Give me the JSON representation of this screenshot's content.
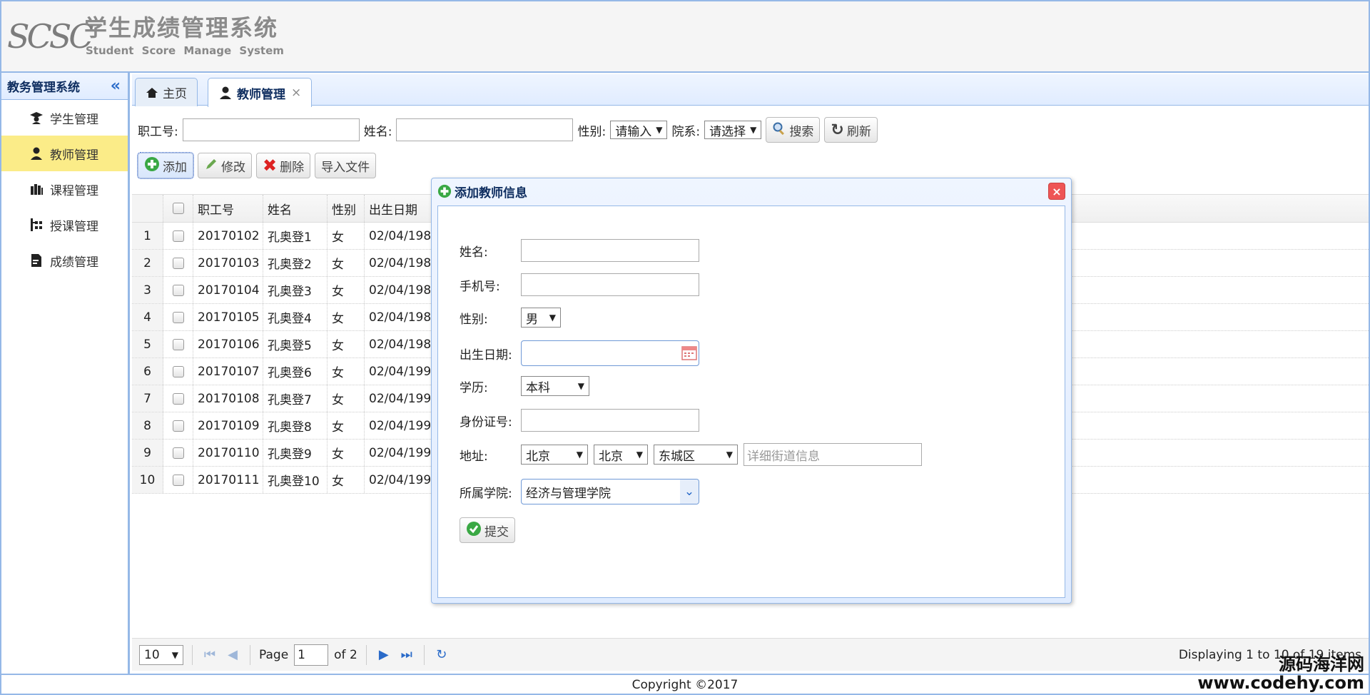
{
  "header": {
    "logo_mark": "SCSC",
    "title": "学生成绩管理系统",
    "subtitle": "Student Score Manage System"
  },
  "sidebar": {
    "title": "教务管理系统",
    "collapse_icon": "double-chevron-left-icon",
    "items": [
      {
        "label": "学生管理",
        "icon": "graduate-icon"
      },
      {
        "label": "教师管理",
        "icon": "teacher-icon",
        "active": true
      },
      {
        "label": "课程管理",
        "icon": "books-icon"
      },
      {
        "label": "授课管理",
        "icon": "hierarchy-icon"
      },
      {
        "label": "成绩管理",
        "icon": "document-icon"
      }
    ]
  },
  "tabs": [
    {
      "label": "主页",
      "icon": "home-icon"
    },
    {
      "label": "教师管理",
      "icon": "teacher-icon",
      "active": true,
      "close": "×"
    }
  ],
  "search": {
    "id_label": "职工号:",
    "name_label": "姓名:",
    "gender_label": "性别:",
    "gender_value": "请输入",
    "dept_label": "院系:",
    "dept_value": "请选择",
    "search_btn": "搜索",
    "refresh_btn": "刷新"
  },
  "actions": {
    "add": "添加",
    "edit": "修改",
    "delete": "删除",
    "import": "导入文件"
  },
  "table": {
    "columns": [
      "职工号",
      "姓名",
      "性别",
      "出生日期"
    ],
    "rows": [
      {
        "no": "1",
        "id": "20170102",
        "name": "孔奥登1",
        "gender": "女",
        "birth": "02/04/198"
      },
      {
        "no": "2",
        "id": "20170103",
        "name": "孔奥登2",
        "gender": "女",
        "birth": "02/04/198"
      },
      {
        "no": "3",
        "id": "20170104",
        "name": "孔奥登3",
        "gender": "女",
        "birth": "02/04/198"
      },
      {
        "no": "4",
        "id": "20170105",
        "name": "孔奥登4",
        "gender": "女",
        "birth": "02/04/198"
      },
      {
        "no": "5",
        "id": "20170106",
        "name": "孔奥登5",
        "gender": "女",
        "birth": "02/04/198"
      },
      {
        "no": "6",
        "id": "20170107",
        "name": "孔奥登6",
        "gender": "女",
        "birth": "02/04/199"
      },
      {
        "no": "7",
        "id": "20170108",
        "name": "孔奥登7",
        "gender": "女",
        "birth": "02/04/199"
      },
      {
        "no": "8",
        "id": "20170109",
        "name": "孔奥登8",
        "gender": "女",
        "birth": "02/04/199"
      },
      {
        "no": "9",
        "id": "20170110",
        "name": "孔奥登9",
        "gender": "女",
        "birth": "02/04/199"
      },
      {
        "no": "10",
        "id": "20170111",
        "name": "孔奥登10",
        "gender": "女",
        "birth": "02/04/199"
      }
    ]
  },
  "pager": {
    "page_size": "10",
    "page_label": "Page",
    "page_value": "1",
    "of_label": "of 2",
    "display": "Displaying 1 to 10 of 19 items"
  },
  "dialog": {
    "title": "添加教师信息",
    "close": "×",
    "name_label": "姓名:",
    "phone_label": "手机号:",
    "gender_label": "性别:",
    "gender_value": "男",
    "birth_label": "出生日期:",
    "edu_label": "学历:",
    "edu_value": "本科",
    "idcard_label": "身份证号:",
    "addr_label": "地址:",
    "province": "北京",
    "city": "北京",
    "district": "东城区",
    "street_placeholder": "详细街道信息",
    "college_label": "所属学院:",
    "college_value": "经济与管理学院",
    "submit": "提交"
  },
  "footer": {
    "copyright": "Copyright ©2017",
    "watermark_line1": "源码海洋网",
    "watermark_line2": "www.codehy.com"
  },
  "colors": {
    "border": "#95b8e7",
    "active_item": "#fbec88",
    "accent": "#2a6bc9"
  }
}
